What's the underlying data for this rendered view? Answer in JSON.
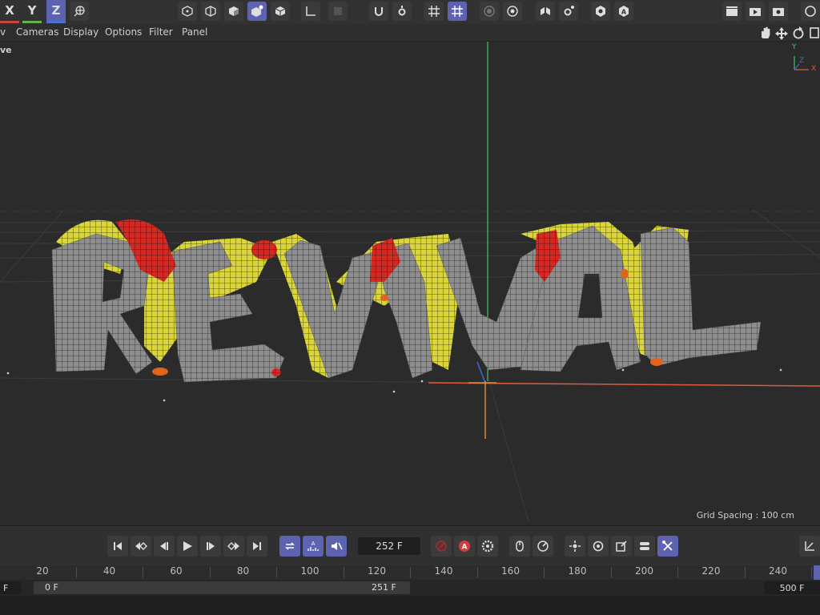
{
  "toolbar": {
    "axes": {
      "x": "X",
      "y": "Y",
      "z": "Z"
    },
    "icons": [
      "world-coordinates-icon",
      "cube-object-icon",
      "polygon-object-icon",
      "model-mode-icon",
      "points-mode-icon",
      "edges-mode-icon",
      "axis-icon",
      "solo-icon",
      "snap-magnet-icon",
      "snap-settings-icon",
      "grid-icon",
      "workplane-grid-icon",
      "render-region-icon",
      "viewport-settings-icon",
      "symmetry-icon",
      "modeling-settings-icon",
      "visibility-icon",
      "auto-icon",
      "render-view-icon",
      "render-picture-viewer-icon",
      "render-settings-icon",
      "layout-icon"
    ]
  },
  "menubar": {
    "items": [
      "v",
      "Cameras",
      "Display",
      "Options",
      "Filter",
      "Panel"
    ]
  },
  "viewport": {
    "label": "ve",
    "grid_spacing": "Grid Spacing : 100 cm",
    "gizmo": {
      "x": "X",
      "y": "Y",
      "z": "Z"
    },
    "colors": {
      "x_axis": "#e05a3a",
      "y_axis": "#3ec46d",
      "z_axis": "#3a6cd6",
      "mesh": "#8e8e8e",
      "yellow": "#d9d53a",
      "red": "#d42a23",
      "orange": "#e0641d"
    }
  },
  "timeline": {
    "current_frame": "252 F",
    "ruler_labels": [
      "20",
      "40",
      "60",
      "80",
      "100",
      "120",
      "140",
      "160",
      "180",
      "200",
      "220",
      "240"
    ],
    "range_start_left": "F",
    "range_start": "0 F",
    "range_mid": "251 F",
    "range_end": "500 F"
  }
}
